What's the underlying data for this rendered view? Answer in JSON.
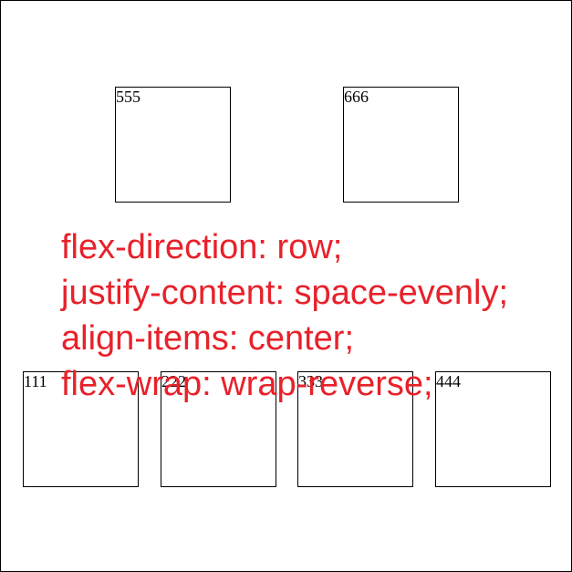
{
  "boxes": {
    "b555": "555",
    "b666": "666",
    "b111": "111",
    "b222": "222",
    "b333": "333",
    "b444": "444"
  },
  "overlay": {
    "line1": "flex-direction: row;",
    "line2": "justify-content: space-evenly;",
    "line3": "align-items: center;",
    "line4": "flex-wrap: wrap-reverse;"
  },
  "colors": {
    "overlay_text": "#e8212a",
    "border": "#000000",
    "background": "#ffffff"
  }
}
